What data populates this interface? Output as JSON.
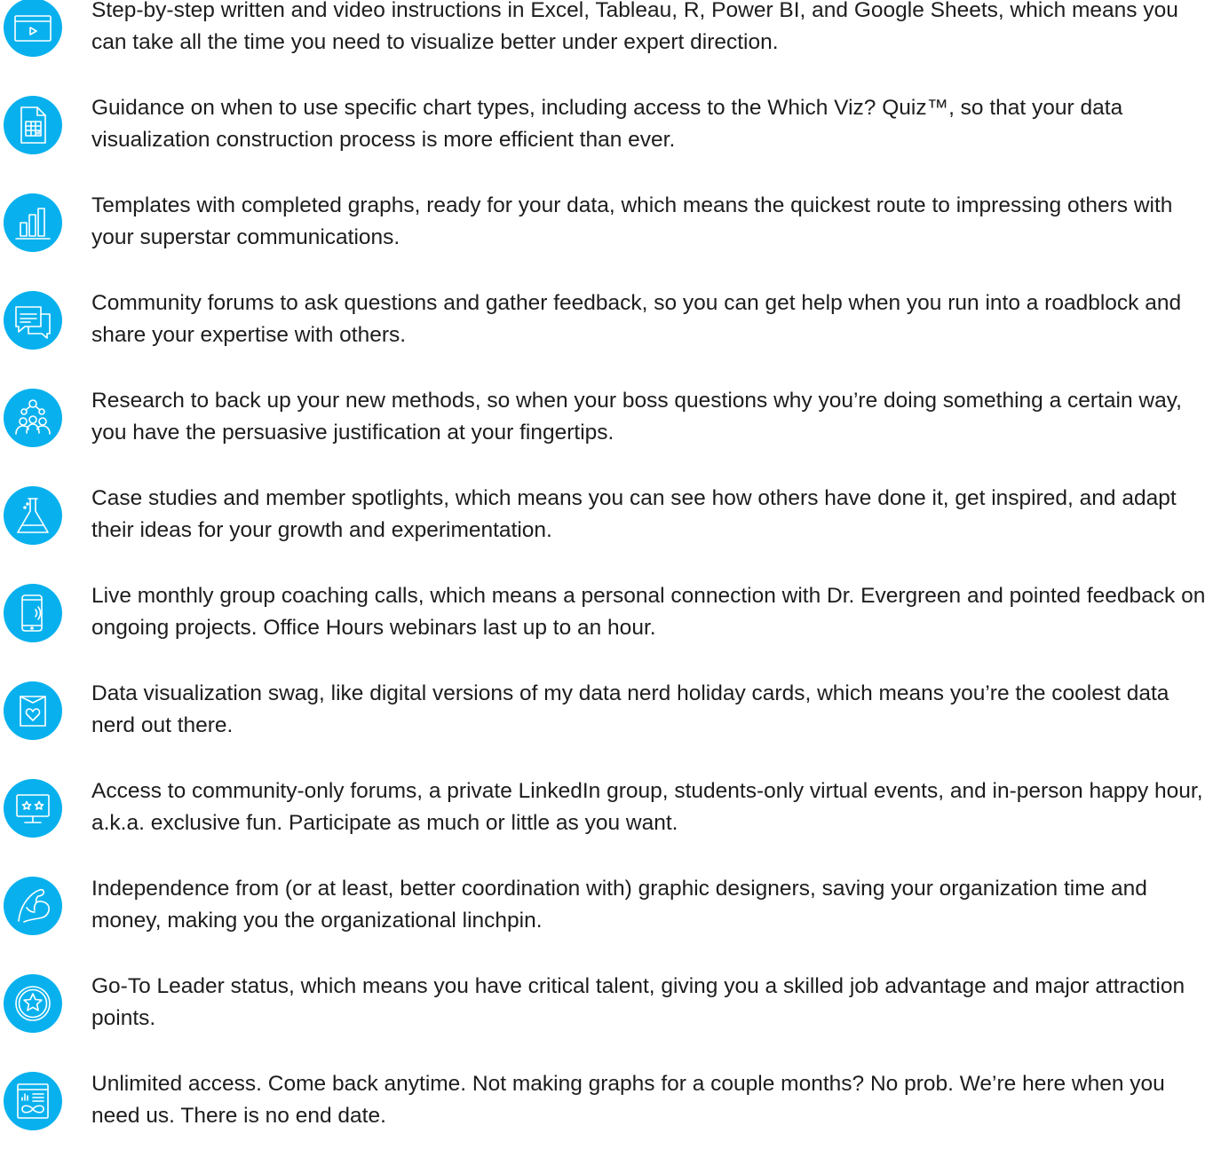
{
  "accent_color": "#08b1ee",
  "benefits": [
    {
      "icon": "video-player-icon",
      "text": "Step-by-step written and video instructions in Excel, Tableau, R, Power BI, and Google Sheets, which means you can take all the time you need to visualize better under expert direction."
    },
    {
      "icon": "spreadsheet-document-icon",
      "text": "Guidance on when to use specific chart types, including access to the Which Viz? Quiz™, so that your data visualization construction process is more efficient than ever."
    },
    {
      "icon": "bar-chart-icon",
      "text": "Templates with completed graphs, ready for your data, which means the quickest route to impressing others with your superstar communications."
    },
    {
      "icon": "chat-bubbles-icon",
      "text": "Community forums to ask questions and gather feedback, so you can get help when you run into a roadblock and share your expertise with others."
    },
    {
      "icon": "people-network-icon",
      "text": "Research to back up your new methods, so when your boss questions why you’re doing something a certain way, you have the persuasive justification at your fingertips."
    },
    {
      "icon": "lab-flask-icon",
      "text": "Case studies and member spotlights, which means you can see how others have done it, get inspired, and adapt their ideas for your growth and experimentation."
    },
    {
      "icon": "ringing-phone-icon",
      "text": "Live monthly group coaching calls, which means a personal connection with Dr. Evergreen and pointed feedback on ongoing projects. Office Hours webinars last up to an hour."
    },
    {
      "icon": "heart-card-icon",
      "text": "Data visualization swag, like digital versions of my data nerd holiday cards, which means you’re the coolest data nerd out there."
    },
    {
      "icon": "monitor-stars-icon",
      "text": "Access to community-only forums, a private LinkedIn group, students-only virtual events, and in-person happy hour, a.k.a. exclusive fun. Participate as much or little as you want."
    },
    {
      "icon": "flexed-arm-icon",
      "text": "Independence from (or at least, better coordination with) graphic designers, saving your organization time and money, making you the organizational linchpin."
    },
    {
      "icon": "star-badge-icon",
      "text": "Go-To Leader status, which means you have critical talent, giving you a skilled job advantage and major attraction points."
    },
    {
      "icon": "infinity-dashboard-icon",
      "text": "Unlimited access. Come back anytime. Not making graphs for a couple months? No prob. We’re here when you need us. There is no end date."
    }
  ]
}
